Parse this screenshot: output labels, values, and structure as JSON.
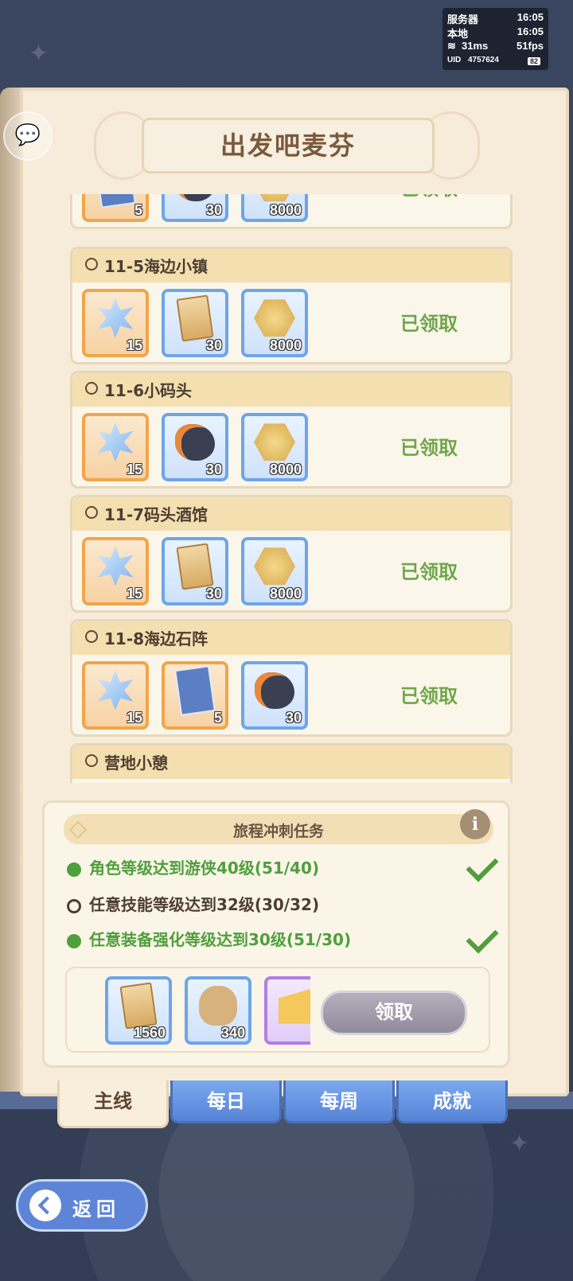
{
  "status": {
    "server_label": "服务器",
    "server_time": "16:05",
    "local_label": "本地",
    "local_time": "16:05",
    "ping": "31ms",
    "fps": "51fps",
    "uid_label": "UID",
    "uid": "4757624",
    "battery": "82"
  },
  "title": "出发吧麦芬",
  "chapters": [
    {
      "label": "",
      "status": "已领取",
      "items": [
        {
          "icon": "blue-card-icon",
          "tier": "orange",
          "count": "5"
        },
        {
          "icon": "ore-icon",
          "tier": "blue",
          "count": "30"
        },
        {
          "icon": "gold-coin-icon",
          "tier": "blue",
          "count": "8000"
        }
      ]
    },
    {
      "label": "11-5海边小镇",
      "status": "已领取",
      "items": [
        {
          "icon": "star-crystal-icon",
          "tier": "orange",
          "count": "15"
        },
        {
          "icon": "gold-card-icon",
          "tier": "blue",
          "count": "30"
        },
        {
          "icon": "gold-coin-icon",
          "tier": "blue",
          "count": "8000"
        }
      ]
    },
    {
      "label": "11-6小码头",
      "status": "已领取",
      "items": [
        {
          "icon": "star-crystal-icon",
          "tier": "orange",
          "count": "15"
        },
        {
          "icon": "ore-icon",
          "tier": "blue",
          "count": "30"
        },
        {
          "icon": "gold-coin-icon",
          "tier": "blue",
          "count": "8000"
        }
      ]
    },
    {
      "label": "11-7码头酒馆",
      "status": "已领取",
      "items": [
        {
          "icon": "star-crystal-icon",
          "tier": "orange",
          "count": "15"
        },
        {
          "icon": "gold-card-icon",
          "tier": "blue",
          "count": "30"
        },
        {
          "icon": "gold-coin-icon",
          "tier": "blue",
          "count": "8000"
        }
      ]
    },
    {
      "label": "11-8海边石阵",
      "status": "已领取",
      "items": [
        {
          "icon": "star-crystal-icon",
          "tier": "orange",
          "count": "15"
        },
        {
          "icon": "blue-card-icon",
          "tier": "orange",
          "count": "5"
        },
        {
          "icon": "ore-icon",
          "tier": "blue",
          "count": "30"
        }
      ]
    },
    {
      "label": "营地小憩",
      "status": "",
      "items": []
    }
  ],
  "sprint": {
    "title": "旅程冲刺任务",
    "info_label": "i",
    "tasks": [
      {
        "text": "角色等级达到游侠40级(51/40)",
        "done": true
      },
      {
        "text": "任意技能等级达到32级(30/32)",
        "done": false
      },
      {
        "text": "任意装备强化等级达到30级(51/30)",
        "done": true
      }
    ],
    "rewards": [
      {
        "icon": "gold-card-icon",
        "tier": "blue",
        "count": "1560"
      },
      {
        "icon": "paw-bag-icon",
        "tier": "blue",
        "count": "340"
      },
      {
        "icon": "cheese-icon",
        "tier": "purple",
        "count": ""
      }
    ],
    "claim_label": "领取"
  },
  "tabs": [
    "主线",
    "每日",
    "每周",
    "成就"
  ],
  "back_label": "返回"
}
